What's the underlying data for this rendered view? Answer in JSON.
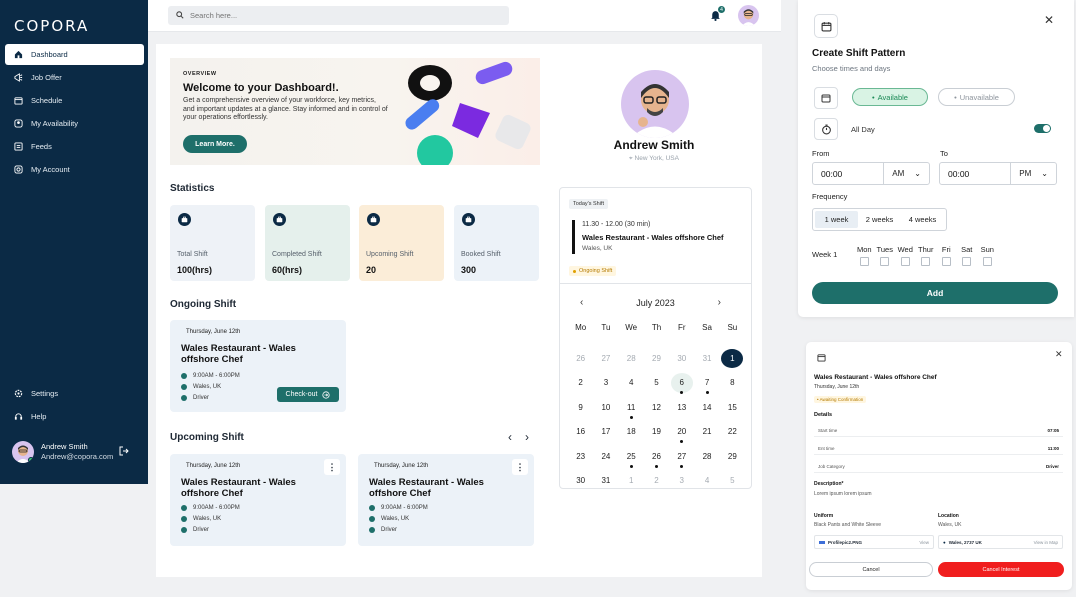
{
  "app": {
    "logo": "COPORA"
  },
  "sidebar": {
    "items": [
      {
        "label": "Dashboard",
        "icon": "home-icon",
        "active": true
      },
      {
        "label": "Job Offer",
        "icon": "megaphone-icon"
      },
      {
        "label": "Schedule",
        "icon": "calendar-icon"
      },
      {
        "label": "My Availability",
        "icon": "user-icon"
      },
      {
        "label": "Feeds",
        "icon": "feeds-icon"
      },
      {
        "label": "My Account",
        "icon": "account-icon"
      }
    ],
    "bottom": [
      {
        "label": "Settings",
        "icon": "gear-icon"
      },
      {
        "label": "Help",
        "icon": "headset-icon"
      }
    ],
    "user": {
      "name": "Andrew Smith",
      "email": "Andrew@copora.com"
    }
  },
  "topbar": {
    "search_placeholder": "Search here...",
    "notif_count": "4"
  },
  "welcome": {
    "overview": "OVERVIEW",
    "title": "Welcome to your Dashboard!.",
    "text": "Get a comprehensive overview of your workforce, key metrics, and important updates at a glance. Stay informed and in control of your operations effortlessly.",
    "button": "Learn More."
  },
  "statistics": {
    "title": "Statistics",
    "cards": [
      {
        "label": "Total Shift",
        "value": "100(hrs)",
        "bg": "#eef2f7"
      },
      {
        "label": "Completed Shift",
        "value": "60(hrs)",
        "bg": "#e5f0ec"
      },
      {
        "label": "Upcoming Shift",
        "value": "20",
        "bg": "#fbedd8"
      },
      {
        "label": "Booked Shift",
        "value": "300",
        "bg": "#ecf2f8"
      }
    ]
  },
  "ongoing": {
    "title": "Ongoing Shift",
    "card": {
      "date": "Thursday, June 12th",
      "title": "Wales Restaurant - Wales offshore Chef",
      "time": "9:00AM - 6:00PM",
      "location": "Wales, UK",
      "role": "Driver",
      "button": "Check-out"
    }
  },
  "upcoming": {
    "title": "Upcoming Shift",
    "cards": [
      {
        "date": "Thursday, June 12th",
        "title": "Wales Restaurant - Wales offshore Chef",
        "time": "9:00AM - 6:00PM",
        "location": "Wales, UK",
        "role": "Driver"
      },
      {
        "date": "Thursday, June 12th",
        "title": "Wales Restaurant - Wales offshore Chef",
        "time": "9:00AM - 6:00PM",
        "location": "Wales, UK",
        "role": "Driver"
      }
    ]
  },
  "profile": {
    "name": "Andrew Smith",
    "location": "New York, USA"
  },
  "today": {
    "tag": "Today's Shift",
    "time": "11.30 - 12.00 (30 min)",
    "title": "Wales Restaurant - Wales offshore Chef",
    "location": "Wales, UK",
    "status": "Ongoing Shift"
  },
  "calendar": {
    "month": "July 2023",
    "dow": [
      "Mo",
      "Tu",
      "We",
      "Th",
      "Fr",
      "Sa",
      "Su"
    ],
    "days": [
      {
        "d": "26",
        "m": 1
      },
      {
        "d": "27",
        "m": 1
      },
      {
        "d": "28",
        "m": 1
      },
      {
        "d": "29",
        "m": 1
      },
      {
        "d": "30",
        "m": 1
      },
      {
        "d": "31",
        "m": 1
      },
      {
        "d": "1",
        "sel": 1
      },
      {
        "d": "2"
      },
      {
        "d": "3"
      },
      {
        "d": "4"
      },
      {
        "d": "5"
      },
      {
        "d": "6",
        "today": 1,
        "ev": 1
      },
      {
        "d": "7",
        "ev": 1
      },
      {
        "d": "8"
      },
      {
        "d": "9"
      },
      {
        "d": "10"
      },
      {
        "d": "11",
        "ev": 1
      },
      {
        "d": "12"
      },
      {
        "d": "13"
      },
      {
        "d": "14"
      },
      {
        "d": "15"
      },
      {
        "d": "16"
      },
      {
        "d": "17"
      },
      {
        "d": "18"
      },
      {
        "d": "19"
      },
      {
        "d": "20",
        "ev": 1
      },
      {
        "d": "21"
      },
      {
        "d": "22"
      },
      {
        "d": "23"
      },
      {
        "d": "24"
      },
      {
        "d": "25",
        "ev": 1
      },
      {
        "d": "26",
        "ev": 1
      },
      {
        "d": "27",
        "ev": 1
      },
      {
        "d": "28"
      },
      {
        "d": "29"
      },
      {
        "d": "30"
      },
      {
        "d": "31"
      },
      {
        "d": "1",
        "m": 1
      },
      {
        "d": "2",
        "m": 1
      },
      {
        "d": "3",
        "m": 1
      },
      {
        "d": "4",
        "m": 1
      },
      {
        "d": "5",
        "m": 1
      }
    ]
  },
  "pattern": {
    "title": "Create Shift Pattern",
    "subtitle": "Choose times and days",
    "available": "Available",
    "unavailable": "Unavailable",
    "allday": "All Day",
    "from_label": "From",
    "to_label": "To",
    "from_value": "00:00",
    "from_unit": "AM",
    "to_value": "00:00",
    "to_unit": "PM",
    "freq_label": "Frequency",
    "freq": [
      "1 week",
      "2 weeks",
      "4 weeks"
    ],
    "week_label": "Week 1",
    "days": [
      "Mon",
      "Tues",
      "Wed",
      "Thur",
      "Fri",
      "Sat",
      "Sun"
    ],
    "add": "Add"
  },
  "detail": {
    "title": "Wales Restaurant - Wales offshore Chef",
    "date": "Thursday, June 12th",
    "status": "Awaiting Confirmation",
    "details": "Details",
    "rows": [
      {
        "k": "Start time",
        "v": "07:05"
      },
      {
        "k": "Ent time",
        "v": "11:00"
      },
      {
        "k": "Job Category",
        "v": "Driver"
      }
    ],
    "desc_label": "Description*",
    "desc": "Lorem ipsum lorem ipsum",
    "uniform_label": "Uniform",
    "uniform": "Black Pants and White Sleeve",
    "location_label": "Location",
    "location": "Wales, UK",
    "file": "Profilepic2.PNG",
    "file_action": "View",
    "map_place": "Wales, 2737 UK",
    "map_action": "View in Map",
    "cancel": "Cancel",
    "cancel_interest": "Cancel Interest"
  }
}
